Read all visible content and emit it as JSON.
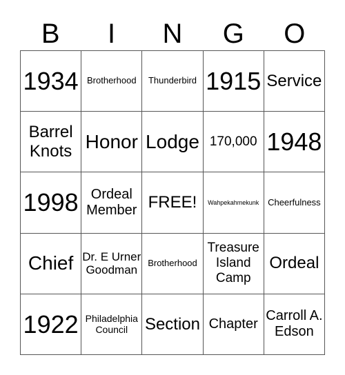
{
  "header": [
    "B",
    "I",
    "N",
    "G",
    "O"
  ],
  "cells": [
    [
      "1934",
      "Brotherhood",
      "Thunderbird",
      "1915",
      "Service"
    ],
    [
      "Barrel Knots",
      "Honor",
      "Lodge",
      "170,000",
      "1948"
    ],
    [
      "1998",
      "Ordeal Member",
      "FREE!",
      "Wahpekahmekunk",
      "Cheerfulness"
    ],
    [
      "Chief",
      "Dr. E Urner Goodman",
      "Brotherhood",
      "Treasure Island Camp",
      "Ordeal"
    ],
    [
      "1922",
      "Philadelphia Council",
      "Section",
      "Chapter",
      "Carroll A. Edson"
    ]
  ]
}
